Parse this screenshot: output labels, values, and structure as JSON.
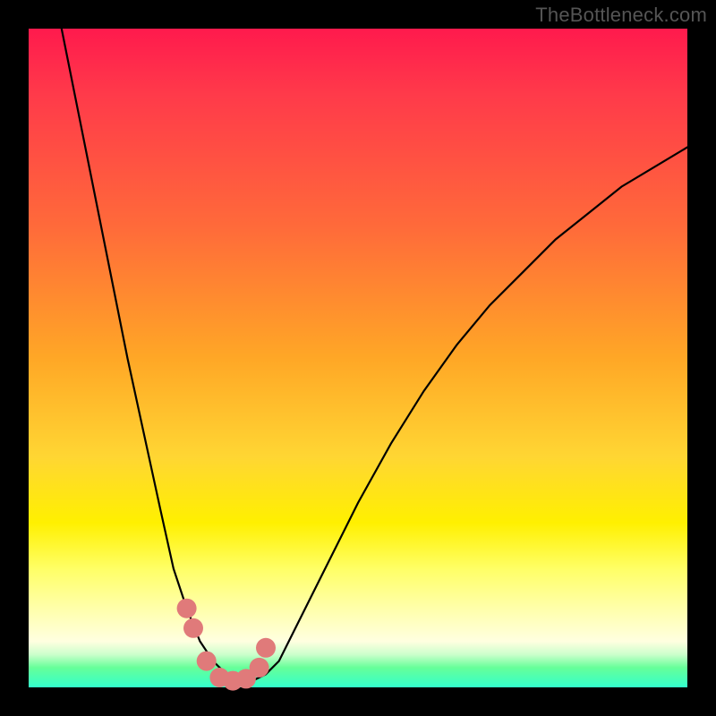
{
  "watermark": "TheBottleneck.com",
  "chart_data": {
    "type": "line",
    "title": "",
    "xlabel": "",
    "ylabel": "",
    "xlim": [
      0,
      100
    ],
    "ylim": [
      0,
      100
    ],
    "series": [
      {
        "name": "bottleneck-curve",
        "x": [
          5,
          10,
          15,
          20,
          22,
          24,
          26,
          28,
          30,
          32,
          34,
          36,
          38,
          40,
          45,
          50,
          55,
          60,
          65,
          70,
          75,
          80,
          85,
          90,
          95,
          100
        ],
        "values": [
          100,
          75,
          50,
          27,
          18,
          12,
          7,
          4,
          2,
          1,
          1,
          2,
          4,
          8,
          18,
          28,
          37,
          45,
          52,
          58,
          63,
          68,
          72,
          76,
          79,
          82
        ]
      }
    ],
    "markers": {
      "name": "highlighted-points",
      "color": "#e07a7a",
      "x": [
        24,
        25,
        27,
        29,
        31,
        33,
        35,
        36
      ],
      "values": [
        12,
        9,
        4,
        1.5,
        1,
        1.3,
        3,
        6
      ]
    },
    "background_gradient": {
      "stops": [
        {
          "pos": 0,
          "color": "#ff1a4d"
        },
        {
          "pos": 30,
          "color": "#ff6a3a"
        },
        {
          "pos": 65,
          "color": "#ffd633"
        },
        {
          "pos": 88,
          "color": "#ffffaa"
        },
        {
          "pos": 97,
          "color": "#66ff99"
        },
        {
          "pos": 100,
          "color": "#33ffcc"
        }
      ]
    }
  }
}
